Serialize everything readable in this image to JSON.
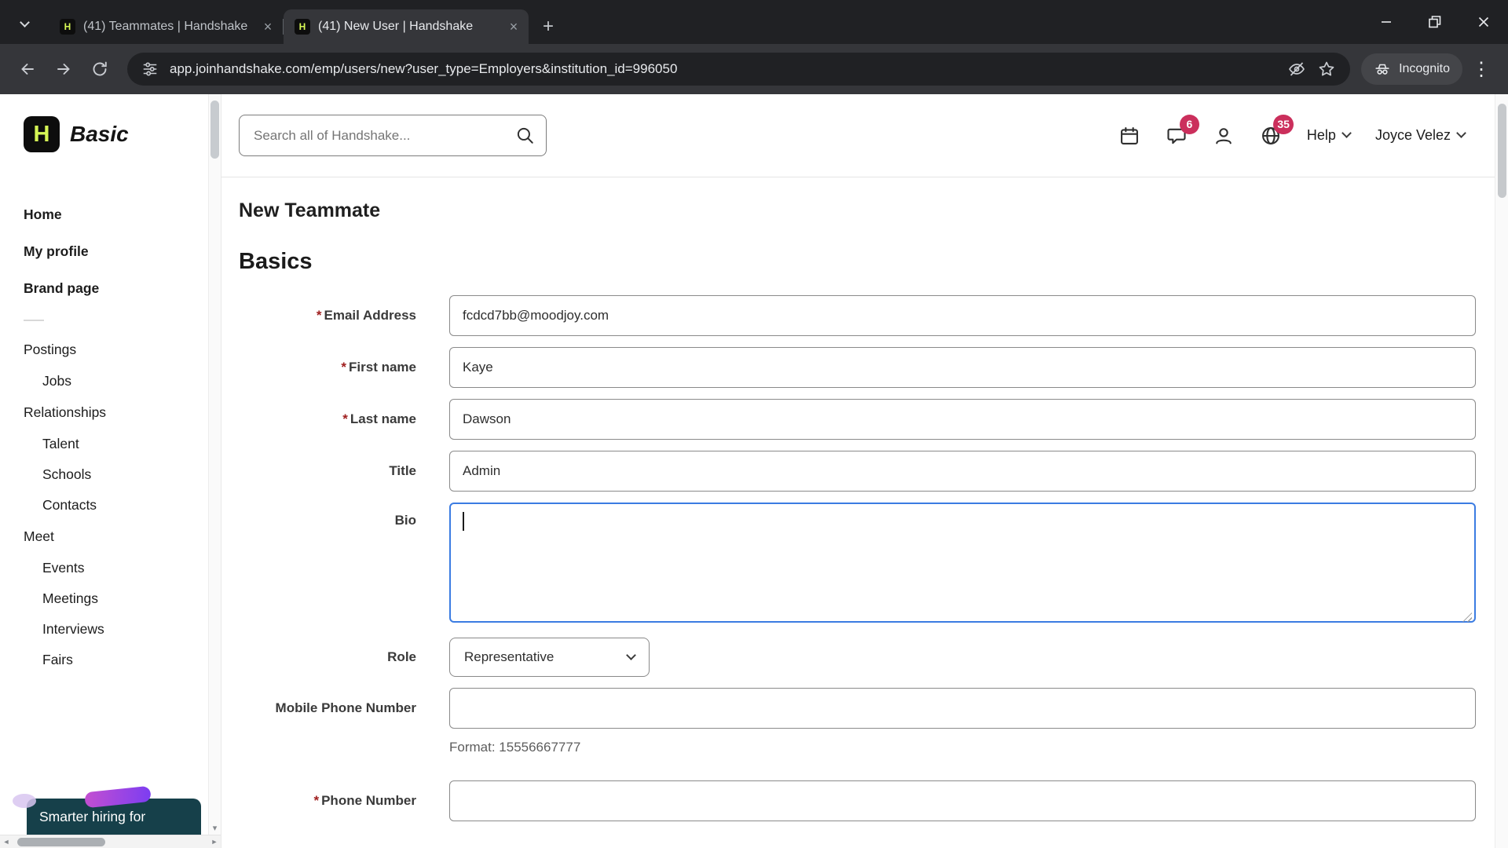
{
  "colors": {
    "brand_green": "#d6f655",
    "badge_red": "#cb2f5c",
    "focus_blue": "#3b7ce2",
    "banner_teal": "#16404a"
  },
  "icons": {
    "caret_down": "▾",
    "caret_left": "◄",
    "caret_right": "►",
    "plus": "+",
    "close": "×",
    "dots": "⋮"
  },
  "browser": {
    "logo_letter": "H",
    "tabs": [
      {
        "title": "(41) Teammates | Handshake"
      },
      {
        "title": "(41) New User | Handshake"
      }
    ],
    "url": "app.joinhandshake.com/emp/users/new?user_type=Employers&institution_id=996050",
    "incognito_label": "Incognito"
  },
  "sidebar": {
    "plan": "Basic",
    "items": [
      {
        "label": "Home"
      },
      {
        "label": "My profile"
      },
      {
        "label": "Brand page"
      },
      {
        "label": "Postings"
      },
      {
        "label": "Jobs"
      },
      {
        "label": "Relationships"
      },
      {
        "label": "Talent"
      },
      {
        "label": "Schools"
      },
      {
        "label": "Contacts"
      },
      {
        "label": "Meet"
      },
      {
        "label": "Events"
      },
      {
        "label": "Meetings"
      },
      {
        "label": "Interviews"
      },
      {
        "label": "Fairs"
      }
    ],
    "banner": "Smarter hiring for"
  },
  "header": {
    "search_placeholder": "Search all of Handshake...",
    "messages_badge": "6",
    "notifications_badge": "35",
    "help_label": "Help",
    "user_name": "Joyce Velez"
  },
  "page": {
    "title": "New Teammate",
    "section_heading": "Basics",
    "required_mark": "*",
    "fields": {
      "email": {
        "label": "Email Address",
        "value": "fcdcd7bb@moodjoy.com"
      },
      "first_name": {
        "label": "First name",
        "value": "Kaye"
      },
      "last_name": {
        "label": "Last name",
        "value": "Dawson"
      },
      "title": {
        "label": "Title",
        "value": "Admin"
      },
      "bio": {
        "label": "Bio",
        "value": ""
      },
      "role": {
        "label": "Role",
        "value": "Representative"
      },
      "mobile": {
        "label": "Mobile Phone Number",
        "value": "",
        "helper": "Format: 15556667777"
      },
      "phone": {
        "label": "Phone Number",
        "value": ""
      }
    }
  }
}
